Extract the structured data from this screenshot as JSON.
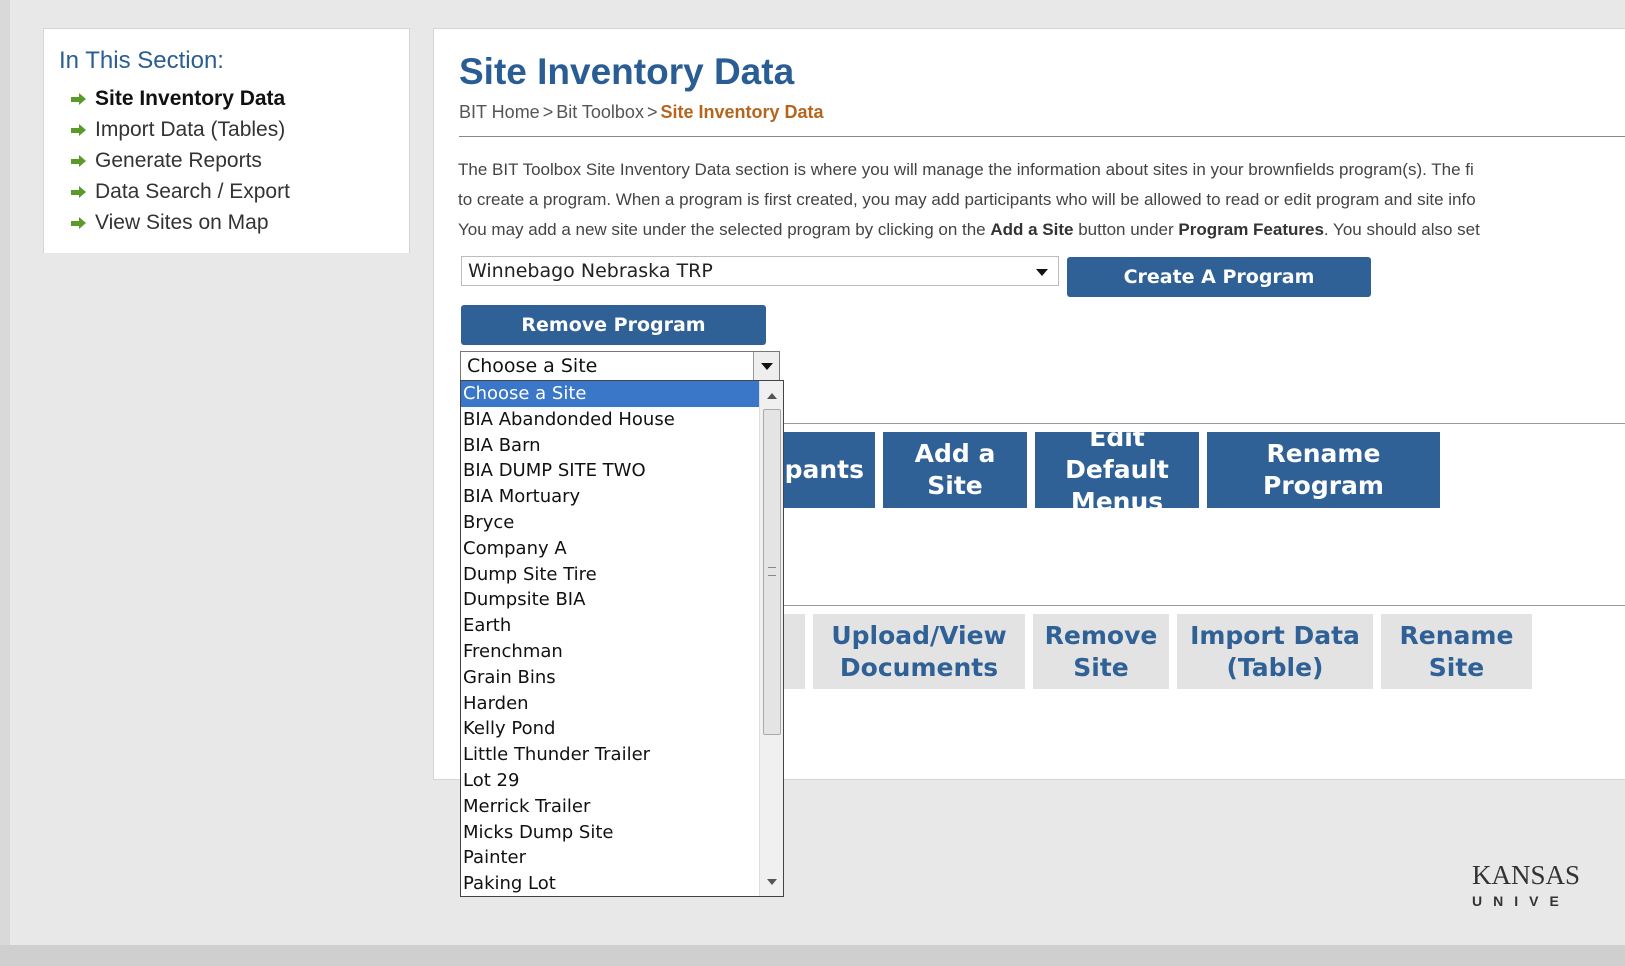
{
  "sidebar": {
    "title": "In This Section:",
    "items": [
      {
        "label": "Site Inventory Data"
      },
      {
        "label": "Import Data (Tables)"
      },
      {
        "label": "Generate Reports"
      },
      {
        "label": "Data Search / Export"
      },
      {
        "label": "View Sites on Map"
      }
    ]
  },
  "main": {
    "title": "Site Inventory Data",
    "breadcrumb": {
      "home": "BIT Home",
      "sep": ">",
      "toolbox": "Bit Toolbox",
      "current": "Site Inventory Data"
    },
    "intro": {
      "line1": "The BIT Toolbox Site Inventory Data section is where you will manage the information about sites in your brownfields program(s). The fi",
      "line2": "to create a program.  When a program is first created, you may add participants who will be allowed to read or edit program and site info",
      "line3_a": "You may add a new site under the selected program by clicking on the ",
      "line3_b": "Add a Site",
      "line3_c": " button under ",
      "line3_d": "Program Features",
      "line3_e": ". You should also set"
    },
    "program_select": {
      "value": "Winnebago Nebraska TRP"
    },
    "create_program": "Create A Program",
    "remove_program": "Remove Program",
    "site_select": {
      "value": "Choose a Site"
    },
    "program_features": {
      "participants": "ipants",
      "add_site": "Add a Site",
      "edit_menus": "Edit Default Menus",
      "rename_program": "Rename Program"
    },
    "site_features": {
      "upload": "Upload/View Documents",
      "remove": "Remove Site",
      "import": "Import Data (Table)",
      "rename": "Rename Site"
    }
  },
  "site_dropdown": {
    "options": [
      "Choose a Site",
      "BIA Abandonded House",
      "BIA Barn",
      "BIA DUMP SITE TWO",
      "BIA Mortuary",
      "Bryce",
      "Company A",
      "Dump Site Tire",
      "Dumpsite BIA",
      "Earth",
      "Frenchman",
      "Grain Bins",
      "Harden",
      "Kelly Pond",
      "Little Thunder Trailer",
      "Lot 29",
      "Merrick Trailer",
      "Micks Dump Site",
      "Painter",
      "Paking Lot"
    ],
    "selected_index": 0
  },
  "footer": {
    "logo_name": "KANSAS",
    "logo_sub": "UNIVE"
  },
  "colors": {
    "accent": "#2f6196",
    "breadcrumb_current": "#b5651d",
    "selection": "#3a77c9",
    "bullet": "#5a9a2a"
  }
}
